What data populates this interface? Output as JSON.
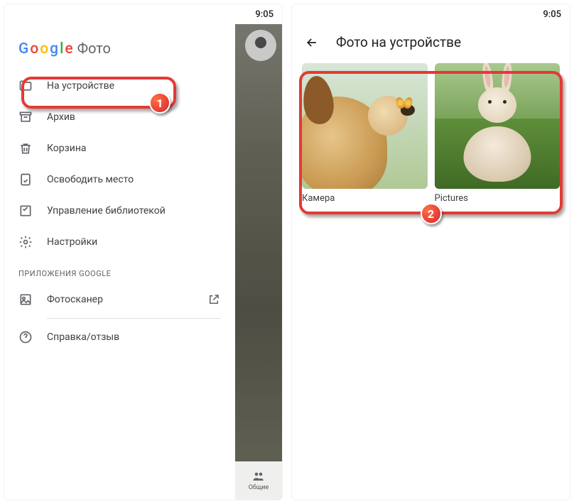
{
  "status_time": "9:05",
  "left": {
    "logo_word": "Google",
    "logo_suffix": "Фото",
    "menu": {
      "on_device": "На устройстве",
      "archive": "Архив",
      "trash": "Корзина",
      "free_space": "Освободить место",
      "manage_library": "Управление библиотекой",
      "settings": "Настройки"
    },
    "section_google_apps": "Приложения Google",
    "menu2": {
      "photoscan": "Фотосканер",
      "help": "Справка/отзыв"
    },
    "bottom_tab_shared": "Общие",
    "step_badge": "1"
  },
  "right": {
    "title": "Фото на устройстве",
    "albums": [
      {
        "label": "Камера"
      },
      {
        "label": "Pictures"
      }
    ],
    "step_badge": "2"
  }
}
